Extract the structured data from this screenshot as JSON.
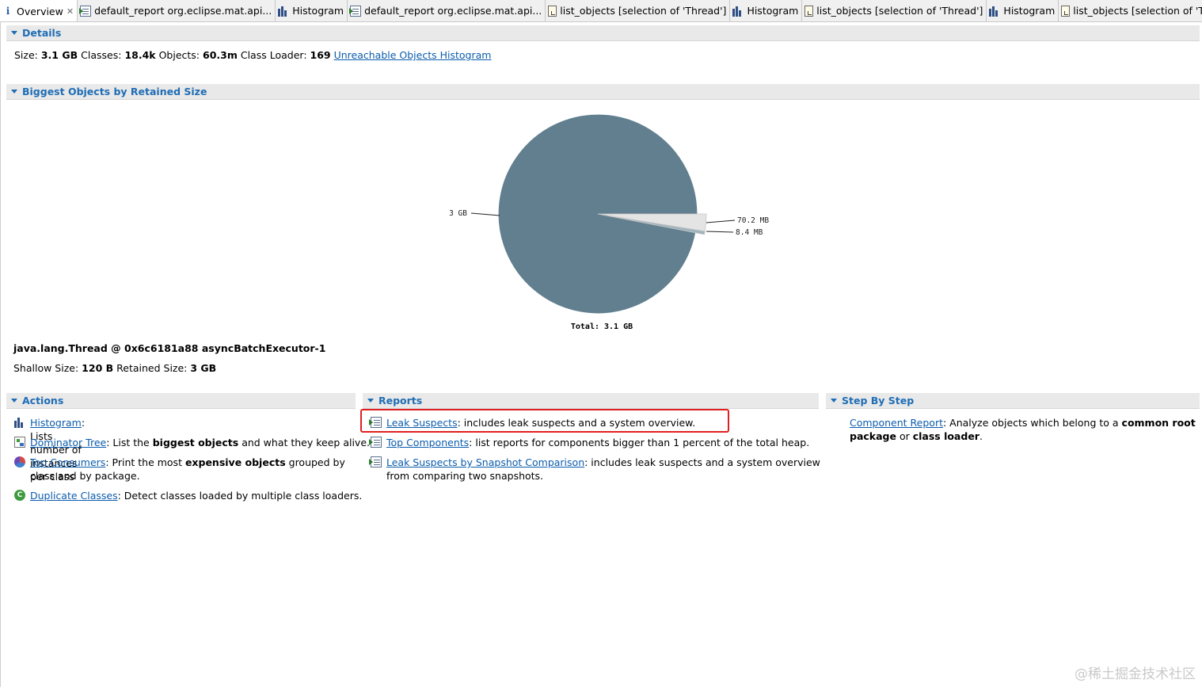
{
  "tabs": [
    {
      "label": "Overview",
      "icon": "info-icon",
      "active": true,
      "closable": true
    },
    {
      "label": "default_report  org.eclipse.mat.api...",
      "icon": "report-icon"
    },
    {
      "label": "Histogram",
      "icon": "histogram-icon"
    },
    {
      "label": "default_report  org.eclipse.mat.api...",
      "icon": "report-icon"
    },
    {
      "label": "list_objects  [selection of 'Thread']",
      "icon": "document-icon"
    },
    {
      "label": "Histogram",
      "icon": "histogram-icon"
    },
    {
      "label": "list_objects  [selection of 'Thread']",
      "icon": "document-icon"
    },
    {
      "label": "Histogram",
      "icon": "histogram-icon"
    },
    {
      "label": "list_objects  [selection of 'Thread']",
      "icon": "document-icon"
    }
  ],
  "details": {
    "title": "Details",
    "size_label": "Size:",
    "size_value": "3.1 GB",
    "classes_label": "Classes:",
    "classes_value": "18.4k",
    "objects_label": "Objects:",
    "objects_value": "60.3m",
    "loader_label": "Class Loader:",
    "loader_value": "169",
    "unreachable_link": "Unreachable Objects Histogram"
  },
  "biggest": {
    "title": "Biggest Objects by Retained Size",
    "object_name": "java.lang.Thread @ 0x6c6181a88 asyncBatchExecutor-1",
    "shallow_label": "Shallow Size:",
    "shallow_value": "120 B",
    "retained_label": "Retained Size:",
    "retained_value": "3 GB"
  },
  "chart_data": {
    "type": "pie",
    "slices": [
      {
        "label": "3 GB",
        "value_mb": 3072,
        "color": "#617f8f"
      },
      {
        "label": "70.2 MB",
        "value_mb": 70.2,
        "color": "#e4e4e4"
      },
      {
        "label": "8.4 MB",
        "value_mb": 8.4,
        "color": "#9fb3bd"
      }
    ],
    "total_label": "Total: 3.1 GB"
  },
  "actions": {
    "title": "Actions",
    "items": [
      {
        "link": "Histogram",
        "rest": ": Lists number of instances per class",
        "icon": "histogram-icon"
      },
      {
        "link": "Dominator Tree",
        "rest_a": ": List the ",
        "bold": "biggest objects",
        "rest_b": " and what they keep alive.",
        "icon": "dominator-tree-icon"
      },
      {
        "link": "Top Consumers",
        "rest_a": ": Print the most ",
        "bold": "expensive objects",
        "rest_b": " grouped by",
        "line2": "class and by package.",
        "icon": "top-consumers-icon"
      },
      {
        "link": "Duplicate Classes",
        "rest": ": Detect classes loaded by multiple class loaders.",
        "icon": "duplicate-classes-icon"
      }
    ]
  },
  "reports": {
    "title": "Reports",
    "items": [
      {
        "link": "Leak Suspects",
        "rest": ": includes leak suspects and a system overview.",
        "icon": "report-icon"
      },
      {
        "link": "Top Components",
        "rest": ": list reports for components bigger than 1 percent of the total heap.",
        "icon": "report-icon"
      },
      {
        "link": "Leak Suspects by Snapshot Comparison",
        "rest": ": includes leak suspects and a system overview",
        "line2": "from comparing two snapshots.",
        "icon": "report-icon"
      }
    ]
  },
  "steps": {
    "title": "Step By Step",
    "link": "Component Report",
    "rest_a": ": Analyze objects which belong to a ",
    "bold_a": "common root",
    "bold_b": "package",
    "rest_b": " or ",
    "bold_c": "class loader",
    "rest_c": "."
  },
  "watermark": "@稀土掘金技术社区"
}
